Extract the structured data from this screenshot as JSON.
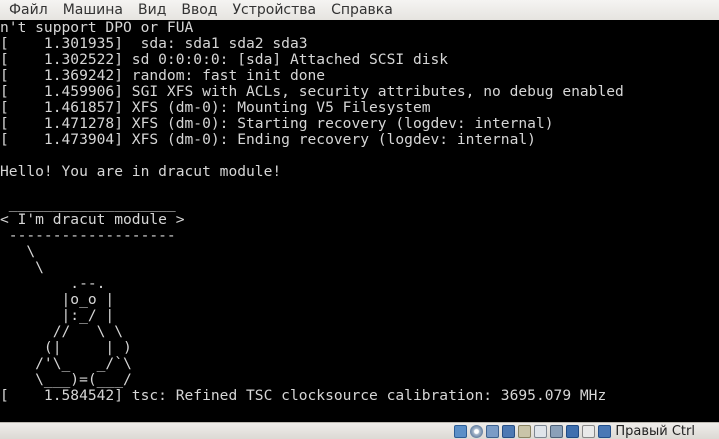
{
  "menubar": {
    "items": [
      "Файл",
      "Машина",
      "Вид",
      "Ввод",
      "Устройства",
      "Справка"
    ]
  },
  "console": {
    "lines": [
      "n't support DPO or FUA",
      "[    1.301935]  sda: sda1 sda2 sda3",
      "[    1.302522] sd 0:0:0:0: [sda] Attached SCSI disk",
      "[    1.369242] random: fast init done",
      "[    1.459906] SGI XFS with ACLs, security attributes, no debug enabled",
      "[    1.461857] XFS (dm-0): Mounting V5 Filesystem",
      "[    1.471278] XFS (dm-0): Starting recovery (logdev: internal)",
      "[    1.473904] XFS (dm-0): Ending recovery (logdev: internal)",
      "",
      "Hello! You are in dracut module!",
      "",
      " ___________________",
      "< I'm dracut module >",
      " -------------------",
      "   \\",
      "    \\",
      "        .--.",
      "       |o_o |",
      "       |:_/ |",
      "      //   \\ \\",
      "     (|     | )",
      "    /'\\_   _/`\\",
      "    \\___)=(___/",
      "[    1.584542] tsc: Refined TSC clocksource calibration: 3695.079 MHz"
    ]
  },
  "statusbar": {
    "icons": [
      "hdd-icon",
      "optical-drive-icon",
      "usb-icon",
      "network-icon",
      "shared-folders-icon",
      "display-icon",
      "video-capture-icon",
      "virtualization-icon",
      "mouse-integration-icon",
      "keyboard-icon"
    ],
    "host_key_label": "Правый Ctrl"
  }
}
